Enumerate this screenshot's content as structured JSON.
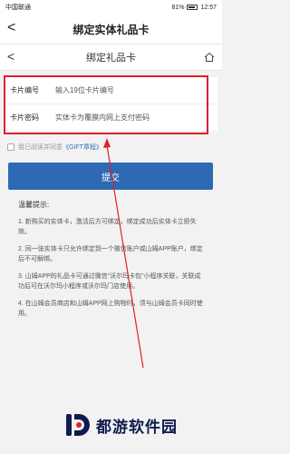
{
  "status": {
    "carrier": "中国联通",
    "battery": "81%",
    "time": "12:57"
  },
  "appbar": {
    "title": "绑定实体礼品卡",
    "back_icon": "<"
  },
  "webbar": {
    "title": "绑定礼品卡",
    "back_icon": "<"
  },
  "form": {
    "card_number_label": "卡片编号",
    "card_number_placeholder": "输入19位卡片编号",
    "card_password_label": "卡片密码",
    "card_password_placeholder": "实体卡为覆膜内网上支付密码"
  },
  "agree": {
    "text": "我已阅读并同意",
    "link": "《GIFT章程》"
  },
  "submit_label": "提交",
  "tips": {
    "head": "温馨提示:",
    "items": [
      "1. 新购买的实体卡，激活后方可绑定，绑定成功后实体卡立即失效。",
      "2. 同一张实体卡只允许绑定到一个微信账户或山姆APP账户，绑定后不可解绑。",
      "3. 山姆APP的礼品卡可通过微信“沃尔玛卡包”小程序关联，关联成功后可在沃尔玛小程序或沃尔玛门店使用。",
      "4. 在山姆会员商店和山姆APP网上购物时，须与山姆会员卡同时使用。"
    ]
  },
  "watermark": {
    "text": "都游软件园"
  },
  "colors": {
    "accent": "#2e69b3",
    "highlight": "#e0202b"
  }
}
